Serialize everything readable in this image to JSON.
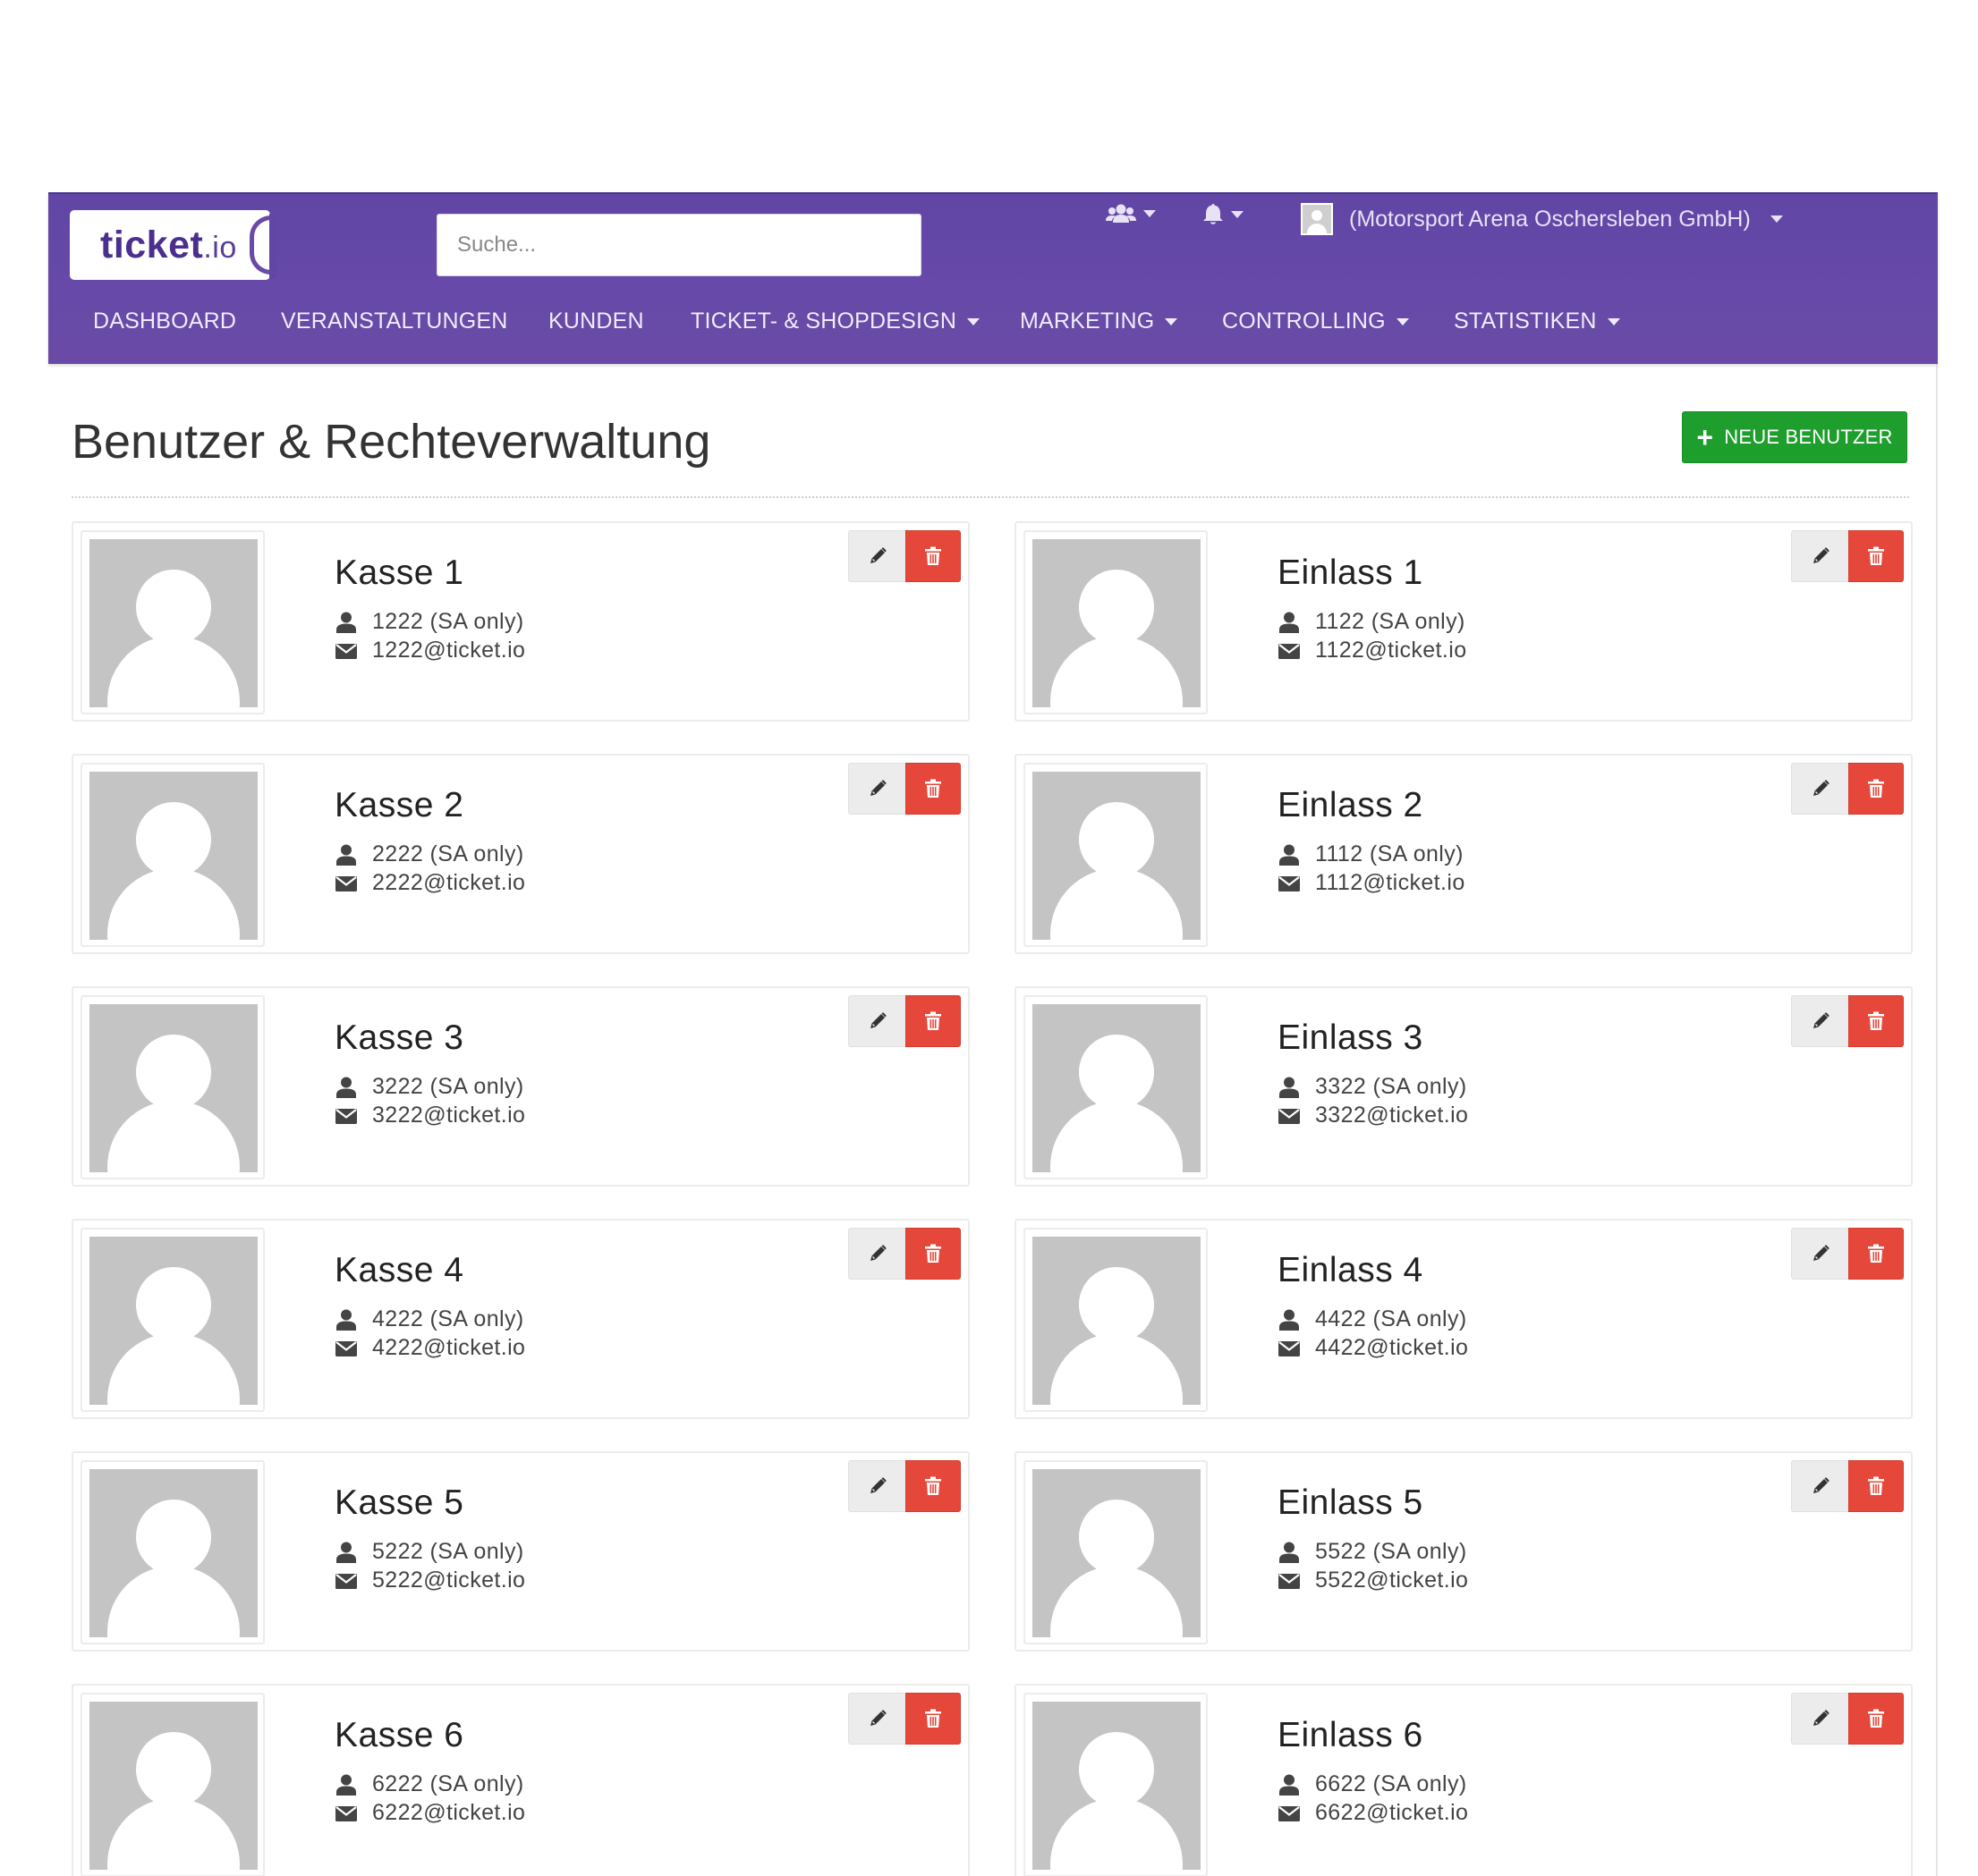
{
  "navbar": {
    "logo_main": "ticket",
    "logo_suffix": ".io",
    "search_placeholder": "Suche...",
    "account_label": "(Motorsport Arena Oschersleben GmbH)",
    "menu": [
      {
        "label": "DASHBOARD",
        "dropdown": false
      },
      {
        "label": "VERANSTALTUNGEN",
        "dropdown": false
      },
      {
        "label": "KUNDEN",
        "dropdown": false
      },
      {
        "label": "TICKET- & SHOPDESIGN",
        "dropdown": true
      },
      {
        "label": "MARKETING",
        "dropdown": true
      },
      {
        "label": "CONTROLLING",
        "dropdown": true
      },
      {
        "label": "STATISTIKEN",
        "dropdown": true
      }
    ]
  },
  "page": {
    "title": "Benutzer & Rechteverwaltung",
    "new_user_label": "NEUE BENUTZER"
  },
  "users": [
    {
      "name": "Kasse 1",
      "login": "1222 (SA only)",
      "email": "1222@ticket.io"
    },
    {
      "name": "Einlass 1",
      "login": "1122 (SA only)",
      "email": "1122@ticket.io"
    },
    {
      "name": "Kasse 2",
      "login": "2222 (SA only)",
      "email": "2222@ticket.io"
    },
    {
      "name": "Einlass 2",
      "login": "1112 (SA only)",
      "email": "1112@ticket.io"
    },
    {
      "name": "Kasse 3",
      "login": "3222 (SA only)",
      "email": "3222@ticket.io"
    },
    {
      "name": "Einlass 3",
      "login": "3322 (SA only)",
      "email": "3322@ticket.io"
    },
    {
      "name": "Kasse 4",
      "login": "4222 (SA only)",
      "email": "4222@ticket.io"
    },
    {
      "name": "Einlass 4",
      "login": "4422 (SA only)",
      "email": "4422@ticket.io"
    },
    {
      "name": "Kasse 5",
      "login": "5222 (SA only)",
      "email": "5222@ticket.io"
    },
    {
      "name": "Einlass 5",
      "login": "5522 (SA only)",
      "email": "5522@ticket.io"
    },
    {
      "name": "Kasse 6",
      "login": "6222 (SA only)",
      "email": "6222@ticket.io"
    },
    {
      "name": "Einlass 6",
      "login": "6622 (SA only)",
      "email": "6622@ticket.io"
    }
  ],
  "colors": {
    "navbar": "#6649a8",
    "success": "#1e9e2c",
    "danger": "#e5483a",
    "avatar_placeholder": "#c4c4c4"
  }
}
